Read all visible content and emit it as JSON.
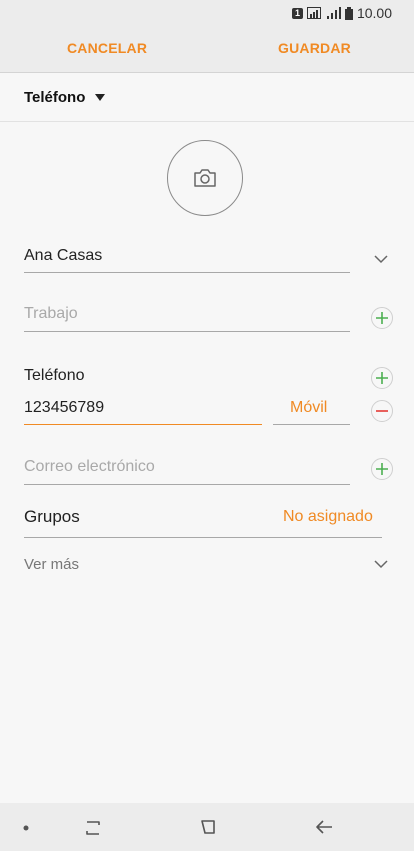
{
  "status": {
    "sim": "1",
    "time": "10.00"
  },
  "actions": {
    "cancel": "CANCELAR",
    "save": "GUARDAR"
  },
  "account": {
    "label": "Teléfono"
  },
  "contact": {
    "name": "Ana Casas",
    "work_placeholder": "Trabajo",
    "phone_label": "Teléfono",
    "phone_value": "123456789",
    "phone_type": "Móvil",
    "email_placeholder": "Correo electrónico",
    "groups_label": "Grupos",
    "groups_value": "No asignado",
    "more_label": "Ver más"
  },
  "colors": {
    "accent": "#f08a24",
    "add": "#4caf50",
    "remove": "#e53935"
  },
  "icons": [
    "camera-icon",
    "plus-icon",
    "minus-icon",
    "chevron-down-icon",
    "recents-icon",
    "home-icon",
    "back-icon"
  ]
}
